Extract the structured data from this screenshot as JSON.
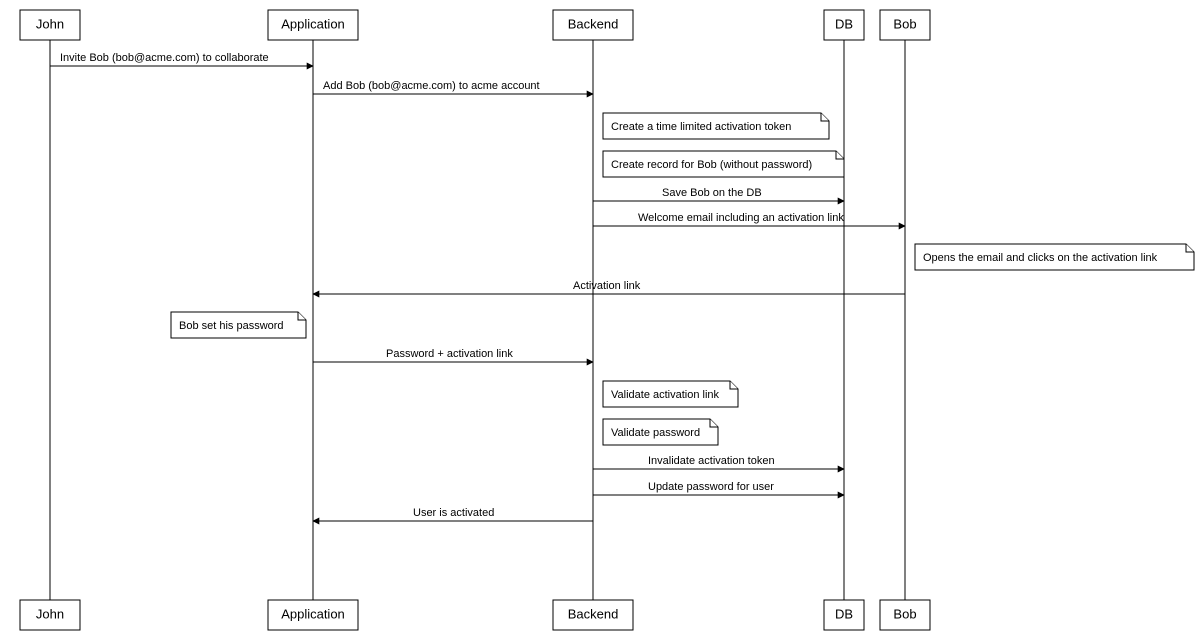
{
  "participants": {
    "john": "John",
    "application": "Application",
    "backend": "Backend",
    "db": "DB",
    "bob": "Bob"
  },
  "messages": {
    "m1": "Invite Bob (bob@acme.com) to collaborate",
    "m2": "Add Bob (bob@acme.com) to acme account",
    "m3": "Save Bob on the DB",
    "m4": "Welcome email including an activation link",
    "m5": "Activation link",
    "m6": "Password + activation link",
    "m7": "Invalidate activation token",
    "m8": "Update password for user",
    "m9": "User is activated"
  },
  "notes": {
    "n1": "Create a time limited activation token",
    "n2": "Create record for Bob (without password)",
    "n3": "Opens the email and clicks on the activation link",
    "n4": "Bob set his password",
    "n5": "Validate activation link",
    "n6": "Validate password"
  },
  "chart_data": {
    "type": "sequence-diagram",
    "participants": [
      "John",
      "Application",
      "Backend",
      "DB",
      "Bob"
    ],
    "steps": [
      {
        "kind": "message",
        "from": "John",
        "to": "Application",
        "text": "Invite Bob (bob@acme.com) to collaborate"
      },
      {
        "kind": "message",
        "from": "Application",
        "to": "Backend",
        "text": "Add Bob (bob@acme.com) to acme account"
      },
      {
        "kind": "note",
        "over": "Backend",
        "text": "Create a time limited activation token"
      },
      {
        "kind": "note",
        "over": "Backend",
        "text": "Create record for Bob (without password)"
      },
      {
        "kind": "message",
        "from": "Backend",
        "to": "DB",
        "text": "Save Bob on the DB"
      },
      {
        "kind": "message",
        "from": "Backend",
        "to": "Bob",
        "text": "Welcome email including an activation link"
      },
      {
        "kind": "note",
        "over": "Bob",
        "text": "Opens the email and clicks on the activation link"
      },
      {
        "kind": "message",
        "from": "Bob",
        "to": "Application",
        "text": "Activation link"
      },
      {
        "kind": "note",
        "over": "Application",
        "text": "Bob set his password"
      },
      {
        "kind": "message",
        "from": "Application",
        "to": "Backend",
        "text": "Password + activation link"
      },
      {
        "kind": "note",
        "over": "Backend",
        "text": "Validate activation link"
      },
      {
        "kind": "note",
        "over": "Backend",
        "text": "Validate password"
      },
      {
        "kind": "message",
        "from": "Backend",
        "to": "DB",
        "text": "Invalidate activation token"
      },
      {
        "kind": "message",
        "from": "Backend",
        "to": "DB",
        "text": "Update password for user"
      },
      {
        "kind": "message",
        "from": "Backend",
        "to": "Application",
        "text": "User is activated"
      }
    ]
  }
}
